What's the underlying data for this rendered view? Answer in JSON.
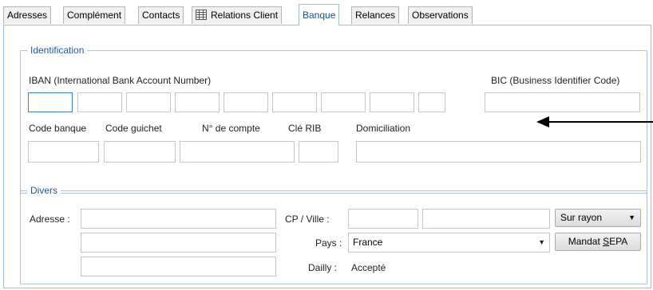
{
  "tabs": [
    {
      "label": "Adresses"
    },
    {
      "label": "Complément"
    },
    {
      "label": "Contacts"
    },
    {
      "label": "Relations Client",
      "icon": "grid-icon"
    },
    {
      "label": "Banque",
      "active": true
    },
    {
      "label": "Relances"
    },
    {
      "label": "Observations"
    }
  ],
  "identification": {
    "legend": "Identification",
    "iban_label": "IBAN (International Bank Account Number)",
    "bic_label": "BIC (Business Identifier Code)",
    "code_banque_label": "Code banque",
    "code_guichet_label": "Code guichet",
    "numero_compte_label": "N° de compte",
    "cle_rib_label": "Clé RIB",
    "domiciliation_label": "Domiciliation"
  },
  "divers": {
    "legend": "Divers",
    "adresse_label": "Adresse :",
    "cp_ville_label": "CP / Ville :",
    "pays_label": "Pays :",
    "pays_value": "France",
    "dailly_label": "Dailly :",
    "dailly_value": "Accepté",
    "sur_rayon_label": "Sur rayon",
    "mandat_prefix": "Mandat ",
    "mandat_accel": "S",
    "mandat_suffix": "EPA"
  },
  "colors": {
    "legend": "#1f5a9c",
    "group_border": "#a8c4e0",
    "focus_border": "#3a80c8"
  }
}
